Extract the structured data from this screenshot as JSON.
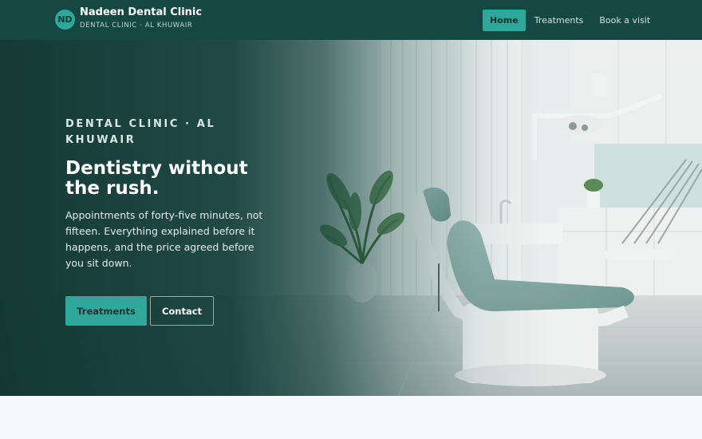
{
  "header": {
    "logo_initials": "ND",
    "brand_name": "Nadeen Dental Clinic",
    "brand_tagline": "DENTAL CLINIC · AL KHUWAIR",
    "nav": [
      {
        "label": "Home",
        "active": true
      },
      {
        "label": "Treatments",
        "active": false
      },
      {
        "label": "Book a visit",
        "active": false
      }
    ]
  },
  "hero": {
    "eyebrow": "DENTAL CLINIC · AL KHUWAIR",
    "title": "Dentistry without the rush.",
    "text": "Appointments of forty-five minutes, not fifteen. Everything explained before it happens, and the price agreed before you sit down.",
    "primary_button": "Treatments",
    "secondary_button": "Contact"
  },
  "colors": {
    "header_bg": "#164843",
    "accent": "#2fa79a",
    "page_bg": "#f5f9f9"
  }
}
